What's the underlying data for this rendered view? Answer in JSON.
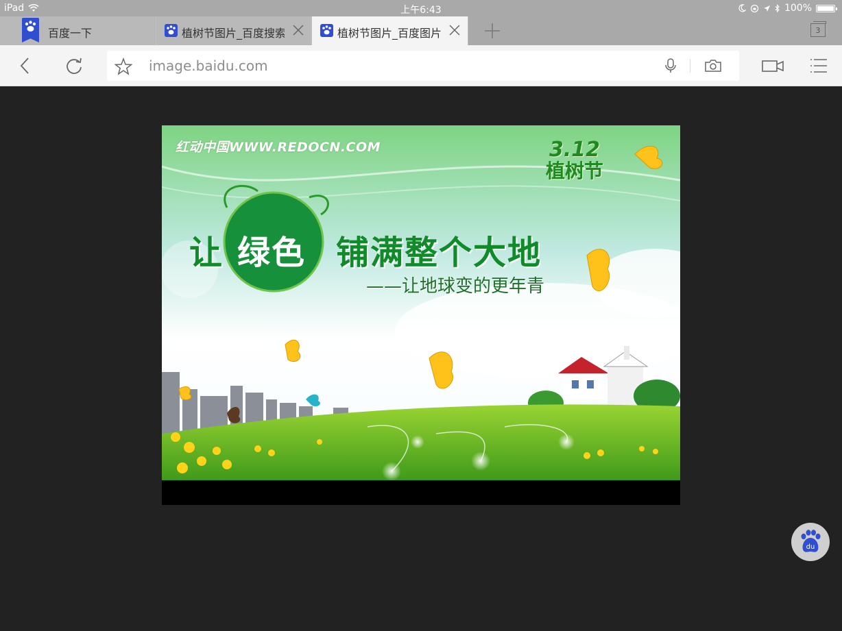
{
  "status_bar": {
    "device": "iPad",
    "time": "上午6:43",
    "battery": "100%",
    "battery_level": 1.0
  },
  "tabs": [
    {
      "label": "百度一下",
      "active": false,
      "closable": false
    },
    {
      "label": "植树节图片_百度搜索",
      "active": false,
      "closable": true
    },
    {
      "label": "植树节图片_百度图片",
      "active": true,
      "closable": true
    }
  ],
  "tab_count": "3",
  "toolbar": {
    "url": "image.baidu.com"
  },
  "image": {
    "watermark": "红动中国WWW.REDOCN.COM",
    "badge_date": "3.12",
    "badge_name": "植树节",
    "headline_part1": "让",
    "headline_part2": "绿色",
    "headline_part3": "铺满整个大地",
    "subline": "——让地球变的更年青"
  },
  "colors": {
    "page_background": "#222222",
    "browser_chrome": "#f4f4f4",
    "tab_strip": "#a9a9a9",
    "accent": "#2f4fd0"
  },
  "icons": [
    "wifi-icon",
    "moon-icon",
    "orientation-lock-icon",
    "location-icon",
    "bluetooth-icon",
    "battery-icon",
    "baidu-paw-icon",
    "close-icon",
    "plus-icon",
    "tabs-icon",
    "back-icon",
    "reload-icon",
    "star-icon",
    "microphone-icon",
    "camera-icon",
    "video-icon",
    "menu-icon"
  ]
}
